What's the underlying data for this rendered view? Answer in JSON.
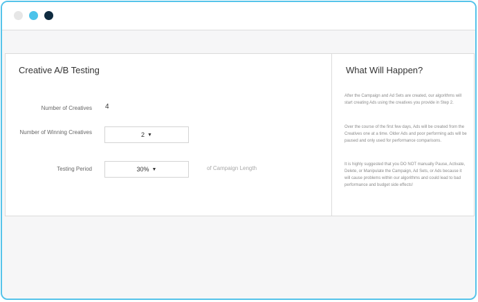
{
  "window": {
    "controls": [
      "close-dot",
      "minimize-dot",
      "maximize-dot"
    ],
    "colors": {
      "dot1": "#e6e6e6",
      "dot2": "#4cc3ea",
      "dot3": "#0f2b40",
      "border": "#55c3ea"
    }
  },
  "testing": {
    "title": "Creative A/B Testing",
    "creatives_label": "Number of Creatives",
    "creatives_value": "4",
    "winning_label": "Number of Winning Creatives",
    "winning_value": "2",
    "period_label": "Testing Period",
    "period_value": "30%",
    "period_suffix": "of Campaign Length",
    "caret_icon": "▼"
  },
  "info": {
    "title": "What Will Happen?",
    "paragraphs": [
      "After the Campaign and Ad Sets are created, our algorithms will start creating Ads using the creatives you provide in Step 2.",
      "Over the course of the first few days, Ads will be created from the Creatives one at a time. Older Ads and poor performing ads will be paused and only used for performance comparisons.",
      "It is highly suggested that you DO NOT manually Pause, Activate, Delete, or Manipulate the Campaign, Ad Sets, or Ads because it will cause problems within our algorithms and could lead to bad performance and budget side effects!"
    ]
  }
}
